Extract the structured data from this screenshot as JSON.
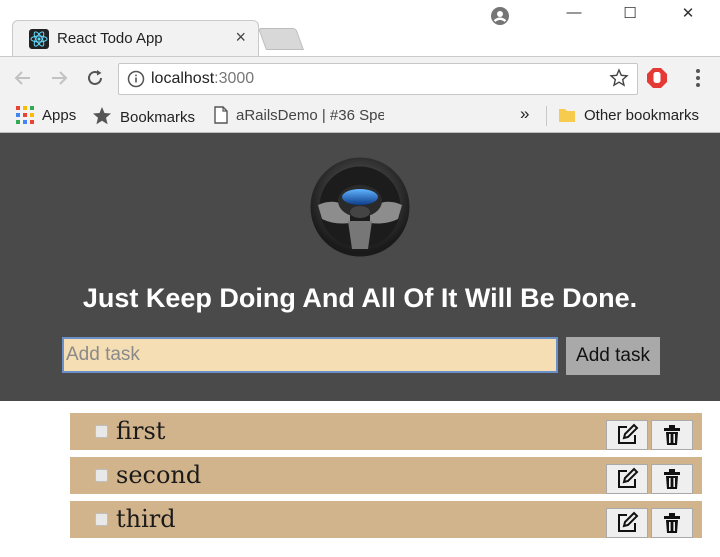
{
  "browser": {
    "tab": {
      "title": "React Todo App",
      "close_glyph": "×",
      "favicon": "react-logo-icon"
    },
    "window_controls": {
      "minimize": "—",
      "maximize": "☐",
      "close": "✕"
    },
    "address": {
      "host": "localhost",
      "port": ":3000"
    },
    "bookmarks": {
      "apps": "Apps",
      "bookmarks": "Bookmarks",
      "page": "aRailsDemo | #36 Spe",
      "overflow": "»",
      "other": "Other bookmarks"
    }
  },
  "app": {
    "headline": "Just Keep Doing And All Of It Will Be Done.",
    "input_placeholder": "Add task",
    "input_value": "",
    "add_button": "Add task",
    "todos": [
      {
        "text": "first",
        "done": false
      },
      {
        "text": "second",
        "done": false
      },
      {
        "text": "third",
        "done": false
      }
    ]
  },
  "colors": {
    "hero_bg": "#4a4a4a",
    "input_bg": "#f5deb3",
    "item_bg": "#d2b48c",
    "add_button_bg": "#a9a9a9"
  }
}
